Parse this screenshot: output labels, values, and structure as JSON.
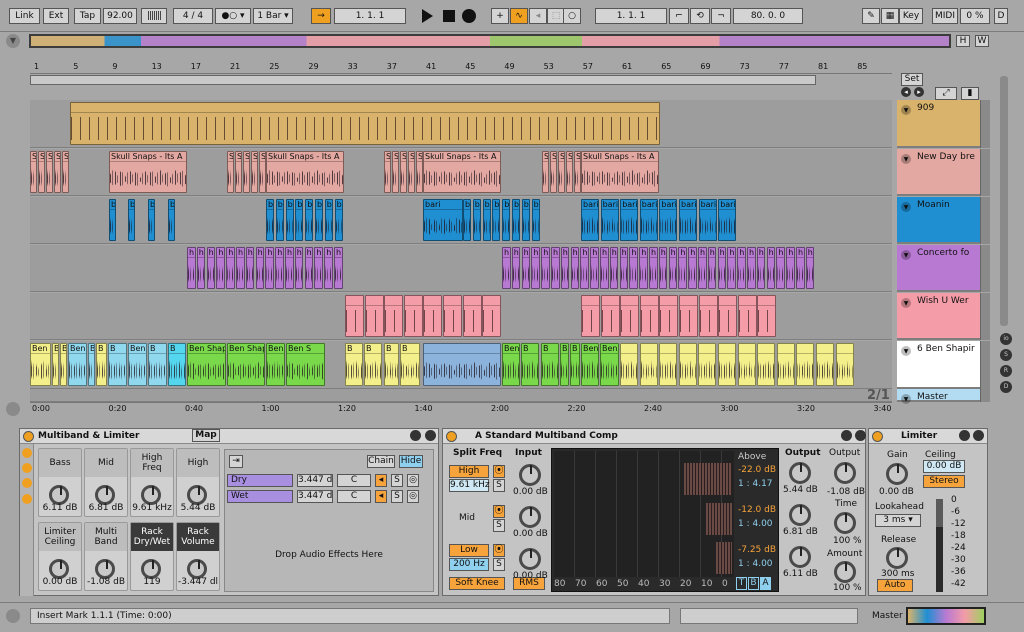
{
  "transport": {
    "link": "Link",
    "ext": "Ext",
    "tap": "Tap",
    "tempo": "92.00",
    "signature": "4 / 4",
    "quantize": "1 Bar",
    "position": "1.  1.  1",
    "loop_start": "1.  1.  1",
    "loop_length": "80.  0.  0",
    "key": "Key",
    "midi": "MIDI",
    "cpu": "0 %",
    "disk": "D"
  },
  "overview": {
    "h": "H",
    "w": "W"
  },
  "beat_ruler": [
    "1",
    "5",
    "9",
    "13",
    "17",
    "21",
    "25",
    "29",
    "33",
    "37",
    "41",
    "45",
    "49",
    "53",
    "57",
    "61",
    "65",
    "69",
    "73",
    "77",
    "81",
    "85"
  ],
  "time_ruler": [
    "0:00",
    "0:20",
    "0:40",
    "1:00",
    "1:20",
    "1:40",
    "2:00",
    "2:20",
    "2:40",
    "3:00",
    "3:20",
    "3:40"
  ],
  "zoom": "2/1",
  "set_label": "Set",
  "tracks": [
    {
      "name": "909",
      "color": "#d9b36b"
    },
    {
      "name": "New Day bre",
      "color": "#e3a8a1"
    },
    {
      "name": "Moanin",
      "color": "#1f8fd2"
    },
    {
      "name": "Concerto fo",
      "color": "#b879d2"
    },
    {
      "name": "Wish U Wer",
      "color": "#f49ca7"
    },
    {
      "name": "6 Ben Shapir",
      "color": "#ffffff"
    },
    {
      "name": "Master",
      "color": "#b3dcf2"
    }
  ],
  "clips": {
    "t1": [
      {
        "l": ""
      }
    ],
    "t2": [
      "S",
      "S",
      "S",
      "S",
      "S",
      "Skull Snaps - Its A",
      "S",
      "S",
      "S",
      "S",
      "S",
      "Skull Snaps - Its A",
      "S",
      "S",
      "S",
      "S",
      "S",
      "Skull Snaps - Its A",
      "S",
      "S",
      "S",
      "S",
      "S",
      "Skull Snaps - Its A"
    ],
    "t3_short": "b",
    "t3_long": "bari",
    "t4": "h",
    "t6": [
      "Ben S",
      "B",
      "B",
      "Ben",
      "Be",
      "B",
      "B",
      "Ben",
      "B",
      "B",
      "Ben Shap",
      "Ben Shap",
      "Ben",
      "Ben S",
      "B",
      "B",
      "B",
      "B",
      "Ben",
      "B",
      "B",
      "B",
      "B",
      "Ben",
      "Ben S"
    ]
  },
  "mb_device": {
    "title": "Multiband & Limiter",
    "map": "Map",
    "macros": [
      {
        "label": "Bass",
        "value": "6.11 dB"
      },
      {
        "label": "Mid",
        "value": "6.81 dB"
      },
      {
        "label": "High Freq",
        "value": "9.61 kHz"
      },
      {
        "label": "High",
        "value": "5.44 dB"
      },
      {
        "label": "Limiter Ceiling",
        "value": "0.00 dB"
      },
      {
        "label": "Multi Band",
        "value": "-1.08 dB"
      },
      {
        "label": "Rack Dry/Wet",
        "value": "119"
      },
      {
        "label": "Rack Volume",
        "value": "-3.447 dl"
      }
    ],
    "chain_btn": "Chain",
    "hide_btn": "Hide",
    "chains": [
      {
        "name": "Dry",
        "vol": "3.447 d",
        "pan": "C",
        "solo": "S"
      },
      {
        "name": "Wet",
        "vol": "3.447 d",
        "pan": "C",
        "solo": "S"
      }
    ],
    "drop_text": "Drop Audio Effects Here"
  },
  "comp_device": {
    "title": "A Standard Multiband Comp",
    "split_freq": "Split Freq",
    "input": "Input",
    "high": "High",
    "high_freq": "9.61 kHz",
    "mid": "Mid",
    "low": "Low",
    "low_freq": "200 Hz",
    "input_values": [
      "0.00 dB",
      "0.00 dB",
      "0.00 dB"
    ],
    "soft_knee": "Soft Knee",
    "rms": "RMS",
    "above": "Above",
    "bands": [
      {
        "thresh": "-22.0 dB",
        "ratio": "1 : 4.17"
      },
      {
        "thresh": "-12.0 dB",
        "ratio": "1 : 4.00"
      },
      {
        "thresh": "-7.25 dB",
        "ratio": "1 : 4.00"
      }
    ],
    "scale": [
      "80",
      "70",
      "60",
      "50",
      "40",
      "30",
      "20",
      "10",
      "0"
    ],
    "tba": [
      "T",
      "B",
      "A"
    ],
    "output": "Output",
    "output_values": [
      "5.44 dB",
      "6.81 dB",
      "6.11 dB"
    ],
    "output2": "Output",
    "output2_value": "-1.08 dB",
    "time": "Time",
    "time_value": "100 %",
    "amount": "Amount",
    "amount_value": "100 %"
  },
  "limiter": {
    "title": "Limiter",
    "gain": "Gain",
    "gain_value": "0.00 dB",
    "ceiling": "Ceiling",
    "ceiling_value": "0.00 dB",
    "stereo": "Stereo",
    "lookahead": "Lookahead",
    "lookahead_value": "3 ms",
    "release": "Release",
    "release_value": "300 ms",
    "auto": "Auto",
    "meter": [
      "0",
      "-6",
      "-12",
      "-18",
      "-24",
      "-30",
      "-36",
      "-42"
    ]
  },
  "status": {
    "text": "Insert Mark 1.1.1 (Time: 0:00)",
    "master": "Master"
  }
}
